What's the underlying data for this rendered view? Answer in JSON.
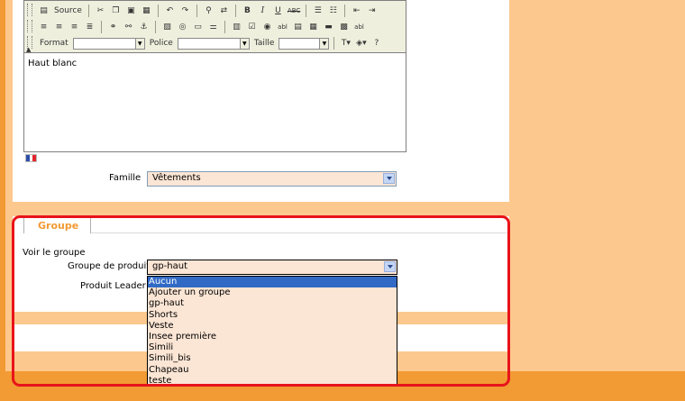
{
  "editor": {
    "toolbar": {
      "source_label": "Source",
      "format_label": "Format",
      "police_label": "Police",
      "taille_label": "Taille",
      "format_value": "",
      "police_value": "",
      "taille_value": ""
    },
    "content": "Haut blanc"
  },
  "famille": {
    "label": "Famille",
    "value": "Vêtements"
  },
  "groupe": {
    "tab_title": "Groupe",
    "voir_label": "Voir le groupe",
    "groupe_produit_label": "Groupe de produit",
    "groupe_produit_value": "gp-haut",
    "produit_leader_label": "Produit Leader",
    "options": [
      "Aucun",
      "Ajouter un groupe",
      "gp-haut",
      "Shorts",
      "Veste",
      "Insee première",
      "Simili",
      "Simili_bis",
      "Chapeau",
      "teste"
    ],
    "highlighted_option": "Aucun"
  },
  "colors": {
    "accent": "#F29A33",
    "peach": "#FDC88D",
    "highlight": "#E8131B",
    "selection": "#316AC5",
    "field_bg": "#FBE5D4"
  }
}
